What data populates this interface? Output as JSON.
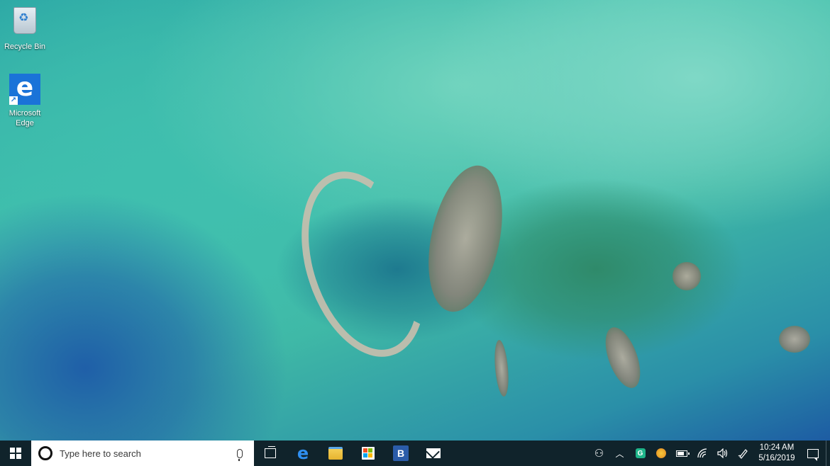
{
  "desktop": {
    "icons": [
      {
        "label": "Recycle Bin",
        "icon": "recycle-bin-icon"
      },
      {
        "label": "Microsoft\nEdge",
        "label_line1": "Microsoft",
        "label_line2": "Edge",
        "icon": "edge-icon"
      }
    ]
  },
  "taskbar": {
    "search": {
      "placeholder": "Type here to search"
    },
    "pinned_apps": [
      {
        "name": "Task View",
        "icon": "task-view-icon"
      },
      {
        "name": "Microsoft Edge",
        "icon": "edge-icon"
      },
      {
        "name": "File Explorer",
        "icon": "file-explorer-icon"
      },
      {
        "name": "Microsoft Store",
        "icon": "store-icon"
      },
      {
        "name": "B",
        "icon": "b-app-icon",
        "glyph": "B"
      },
      {
        "name": "Mail",
        "icon": "mail-icon"
      }
    ],
    "tray": {
      "icons": [
        "people-icon",
        "chevron-up-icon",
        "g-app-icon",
        "security-icon",
        "battery-icon",
        "wifi-icon",
        "volume-icon",
        "pen-icon"
      ],
      "g_glyph": "G"
    },
    "clock": {
      "time": "10:24 AM",
      "date": "5/16/2019"
    }
  },
  "colors": {
    "taskbar_bg": "#10232b",
    "edge_blue": "#1a73d8",
    "search_bg": "#ffffff"
  }
}
